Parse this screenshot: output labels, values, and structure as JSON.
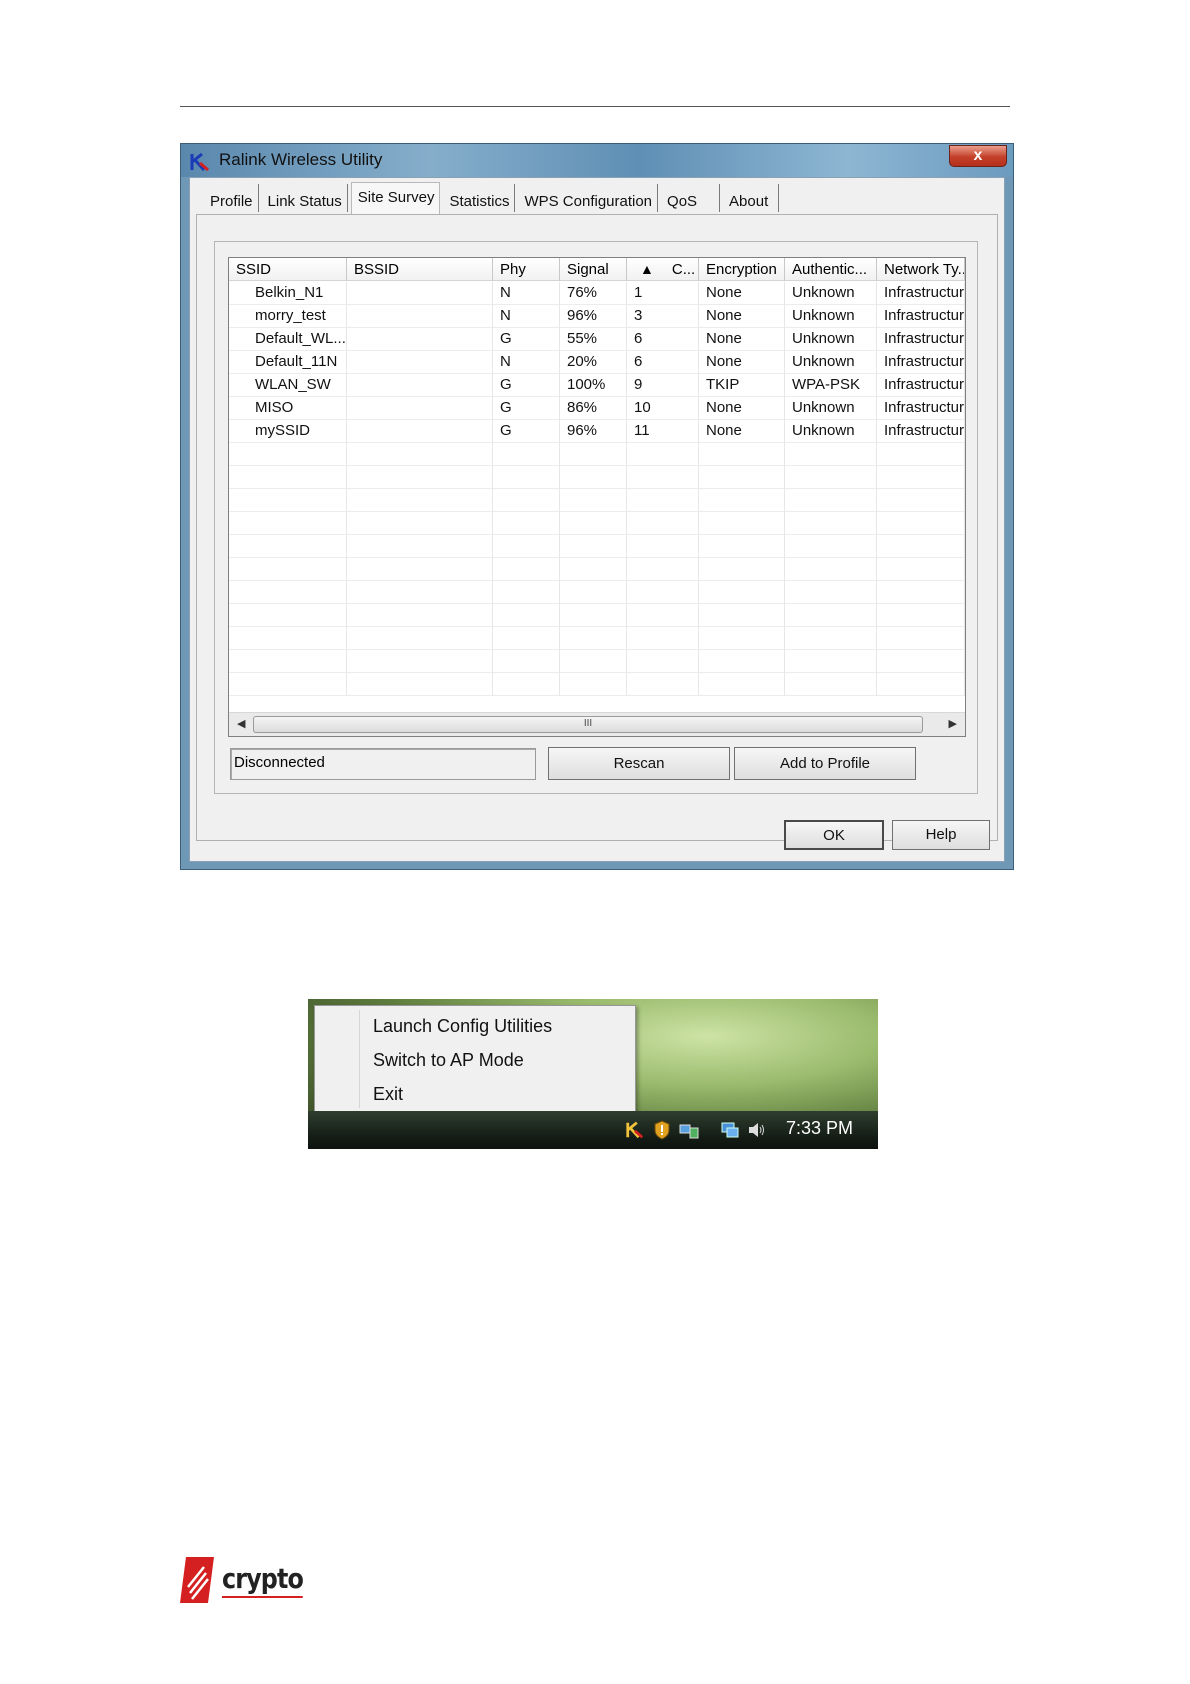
{
  "window": {
    "title": "Ralink Wireless Utility",
    "close_label": "x"
  },
  "tabs": [
    {
      "label": "Profile",
      "active": false
    },
    {
      "label": "Link Status",
      "active": false
    },
    {
      "label": "Site Survey",
      "active": true
    },
    {
      "label": "Statistics",
      "active": false
    },
    {
      "label": "WPS Configuration",
      "active": false
    },
    {
      "label": "QoS",
      "active": false
    },
    {
      "label": "About",
      "active": false
    }
  ],
  "table": {
    "columns": [
      "SSID",
      "BSSID",
      "Phy",
      "Signal",
      "C...",
      "Encryption",
      "Authentic...",
      "Network Ty..."
    ],
    "sort_indicator": "▲",
    "rows": [
      [
        "Belkin_N1",
        "",
        "N",
        "76%",
        "1",
        "None",
        "Unknown",
        "Infrastructure"
      ],
      [
        "morry_test",
        "",
        "N",
        "96%",
        "3",
        "None",
        "Unknown",
        "Infrastructure"
      ],
      [
        "Default_WL...",
        "",
        "G",
        "55%",
        "6",
        "None",
        "Unknown",
        "Infrastructure"
      ],
      [
        "Default_11N",
        "",
        "N",
        "20%",
        "6",
        "None",
        "Unknown",
        "Infrastructure"
      ],
      [
        "WLAN_SW",
        "",
        "G",
        "100%",
        "9",
        "TKIP",
        "WPA-PSK",
        "Infrastructure"
      ],
      [
        "MISO",
        "",
        "G",
        "86%",
        "10",
        "None",
        "Unknown",
        "Infrastructure"
      ],
      [
        "mySSID",
        "",
        "G",
        "96%",
        "11",
        "None",
        "Unknown",
        "Infrastructure"
      ]
    ],
    "scroll_grip": "III"
  },
  "status": {
    "text": "Disconnected"
  },
  "buttons": {
    "rescan": "Rescan",
    "add_to_profile": "Add to Profile",
    "ok": "OK",
    "help": "Help"
  },
  "context_menu": {
    "items": [
      "Launch Config Utilities",
      "Switch to AP Mode",
      "Exit"
    ]
  },
  "taskbar": {
    "clock": "7:33 PM"
  },
  "logo": {
    "text": "crypto"
  },
  "colors": {
    "accent_red": "#d42020",
    "window_frame": "#6f97b6"
  }
}
